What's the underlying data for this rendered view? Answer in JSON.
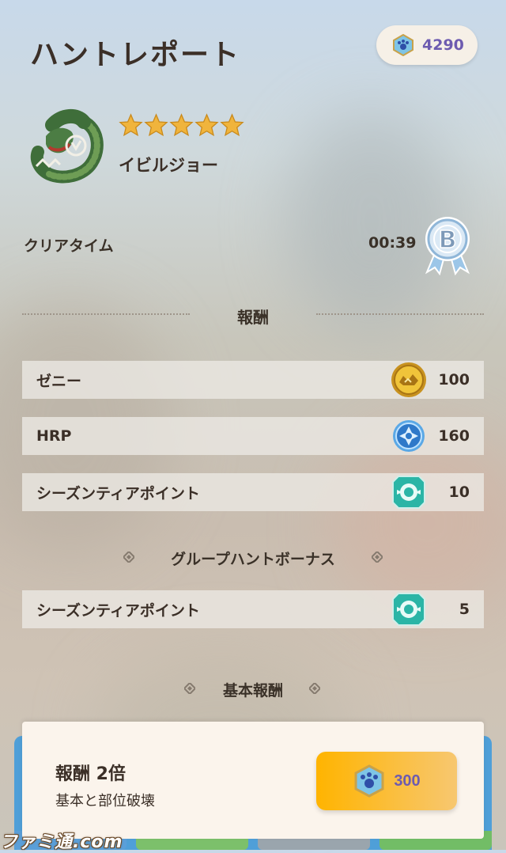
{
  "header": {
    "title": "ハントレポート",
    "currency": {
      "icon": "paw-gem-icon",
      "value": "4290"
    }
  },
  "monster": {
    "name": "イビルジョー",
    "stars": 5,
    "icon": "deviljho-icon"
  },
  "clear": {
    "label": "クリアタイム",
    "time": "00:39",
    "rank": "B"
  },
  "rewards": {
    "title": "報酬",
    "items": [
      {
        "label": "ゼニー",
        "icon": "zenny-coin-icon",
        "amount": "100"
      },
      {
        "label": "HRP",
        "icon": "hrp-orb-icon",
        "amount": "160"
      },
      {
        "label": "シーズンティアポイント",
        "icon": "season-tier-icon",
        "amount": "10"
      }
    ]
  },
  "group_bonus": {
    "title": "グループハントボーナス",
    "items": [
      {
        "label": "シーズンティアポイント",
        "icon": "season-tier-icon",
        "amount": "5"
      }
    ]
  },
  "basic_reward": {
    "title": "基本報酬"
  },
  "double_offer": {
    "title": "報酬 2倍",
    "subtitle": "基本と部位破壊",
    "price": "300",
    "price_icon": "paw-gem-icon"
  },
  "watermark": "ファミ通.com",
  "colors": {
    "accent_purple": "#6d5bb0",
    "button_orange": "#ffb400",
    "star_gold": "#f0b43c"
  }
}
